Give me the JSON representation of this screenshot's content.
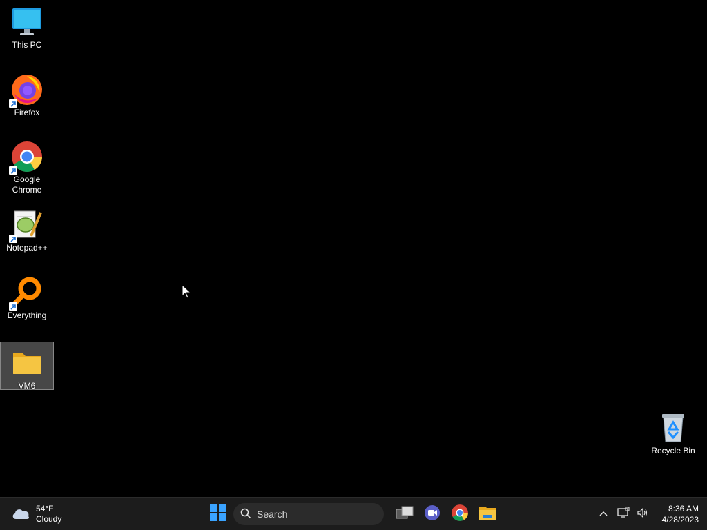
{
  "desktop": {
    "icons": [
      {
        "label": "This PC",
        "icon": "monitor-icon"
      },
      {
        "label": "Firefox",
        "icon": "firefox-icon"
      },
      {
        "label": "Google Chrome",
        "icon": "chrome-icon"
      },
      {
        "label": "Notepad++",
        "icon": "notepadpp-icon"
      },
      {
        "label": "Everything",
        "icon": "everything-search-icon"
      },
      {
        "label": "VM6",
        "icon": "folder-icon",
        "selected": true
      },
      {
        "label": "Recycle Bin",
        "icon": "recycle-bin-icon"
      }
    ]
  },
  "taskbar": {
    "weather": {
      "temp": "54°F",
      "condition": "Cloudy",
      "icon": "cloud-icon"
    },
    "search_label": "Search",
    "pinned": [
      {
        "name": "start",
        "icon": "windows-start-icon"
      },
      {
        "name": "task-view",
        "icon": "task-view-icon"
      },
      {
        "name": "teams",
        "icon": "teams-chat-icon"
      },
      {
        "name": "chrome",
        "icon": "chrome-icon"
      },
      {
        "name": "file-explorer",
        "icon": "file-explorer-icon"
      }
    ],
    "tray": {
      "time": "8:36 AM",
      "date": "4/28/2023"
    }
  },
  "colors": {
    "accent": "#0078d4",
    "taskbar_bg": "#1c1c1c",
    "folder": "#f5c542"
  }
}
